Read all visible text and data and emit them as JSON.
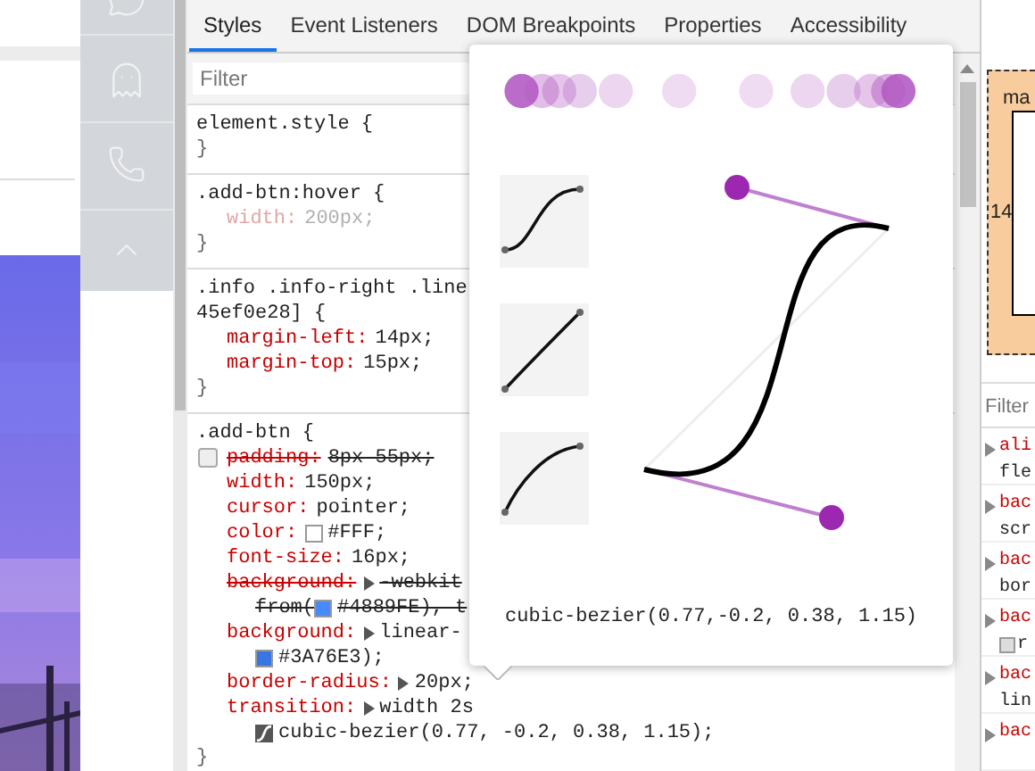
{
  "tabs": [
    {
      "label": "Styles",
      "selected": true
    },
    {
      "label": "Event Listeners",
      "selected": false
    },
    {
      "label": "DOM Breakpoints",
      "selected": false
    },
    {
      "label": "Properties",
      "selected": false
    },
    {
      "label": "Accessibility",
      "selected": false
    }
  ],
  "filter": {
    "placeholder": "Filter"
  },
  "rules": [
    {
      "selector": [
        "element.style {"
      ],
      "close": "}"
    },
    {
      "selector": [
        ".add-btn:hover {"
      ],
      "declarations": [
        {
          "name": "width:",
          "value": "200px;",
          "inactive": true,
          "overridden": false,
          "expandable": false,
          "checkbox_visible": false,
          "checked": true
        }
      ],
      "close": "}"
    },
    {
      "selector": [
        ".info .info-right .line",
        "45ef0e28] {"
      ],
      "declarations": [
        {
          "name": "margin-left:",
          "value": "14px;",
          "inactive": false,
          "overridden": false,
          "expandable": false,
          "checkbox_visible": false,
          "checked": true
        },
        {
          "name": "margin-top:",
          "value": "15px;",
          "inactive": false,
          "overridden": false,
          "expandable": false,
          "checkbox_visible": false,
          "checked": true
        }
      ],
      "close": "}"
    },
    {
      "selector": [
        ".add-btn {"
      ],
      "declarations": [
        {
          "name": "padding:",
          "value": "8px 55px;",
          "inactive": false,
          "overridden": true,
          "expandable": false,
          "checkbox_visible": true,
          "checked": false
        },
        {
          "name": "width:",
          "value": "150px;",
          "inactive": false,
          "overridden": false,
          "expandable": false,
          "checkbox_visible": false,
          "checked": true
        },
        {
          "name": "cursor:",
          "value": "pointer;",
          "inactive": false,
          "overridden": false,
          "expandable": false,
          "checkbox_visible": false,
          "checked": true
        },
        {
          "name": "color:",
          "color": "#ffffff",
          "value": "#FFF;",
          "inactive": false,
          "overridden": false,
          "expandable": false,
          "checkbox_visible": false,
          "checked": true
        },
        {
          "name": "font-size:",
          "value": "16px;",
          "inactive": false,
          "overridden": false,
          "expandable": false,
          "checkbox_visible": false,
          "checked": true
        },
        {
          "name": "background:",
          "value": "-webkit",
          "inactive": false,
          "overridden": true,
          "expandable": true,
          "checkbox_visible": false,
          "checked": true,
          "continuation": {
            "kind": "color",
            "prefix": "from(",
            "color": "#4889fe",
            "text": "#4889FE), t"
          }
        },
        {
          "name": "background:",
          "value": "linear-",
          "inactive": false,
          "overridden": false,
          "expandable": true,
          "checkbox_visible": false,
          "checked": true,
          "continuation": {
            "kind": "color",
            "color": "#3a76e3",
            "text": "#3A76E3);"
          }
        },
        {
          "name": "border-radius:",
          "value": "20px;",
          "inactive": false,
          "overridden": false,
          "expandable": true,
          "checkbox_visible": false,
          "checked": true
        },
        {
          "name": "transition:",
          "value": "width 2s",
          "inactive": false,
          "overridden": false,
          "expandable": true,
          "checkbox_visible": false,
          "checked": true,
          "continuation": {
            "kind": "easing",
            "text": "cubic-bezier(0.77, -0.2, 0.38, 1.15);"
          }
        }
      ],
      "close": "}"
    }
  ],
  "bezier_editor": {
    "value_text": "cubic-bezier(0.77,-0.2, 0.38, 1.15)"
  },
  "box_model": {
    "margin_label": "ma",
    "left_value": "14"
  },
  "computed": {
    "filter": {
      "placeholder": "Filter"
    },
    "properties": [
      {
        "name": "ali",
        "value": "fle"
      },
      {
        "name": "bac",
        "value": "scr"
      },
      {
        "name": "bac",
        "value": "bor"
      },
      {
        "name": "bac",
        "swatch": true,
        "value": "r"
      },
      {
        "name": "bac",
        "value": "lin"
      },
      {
        "name": "bac"
      }
    ]
  }
}
